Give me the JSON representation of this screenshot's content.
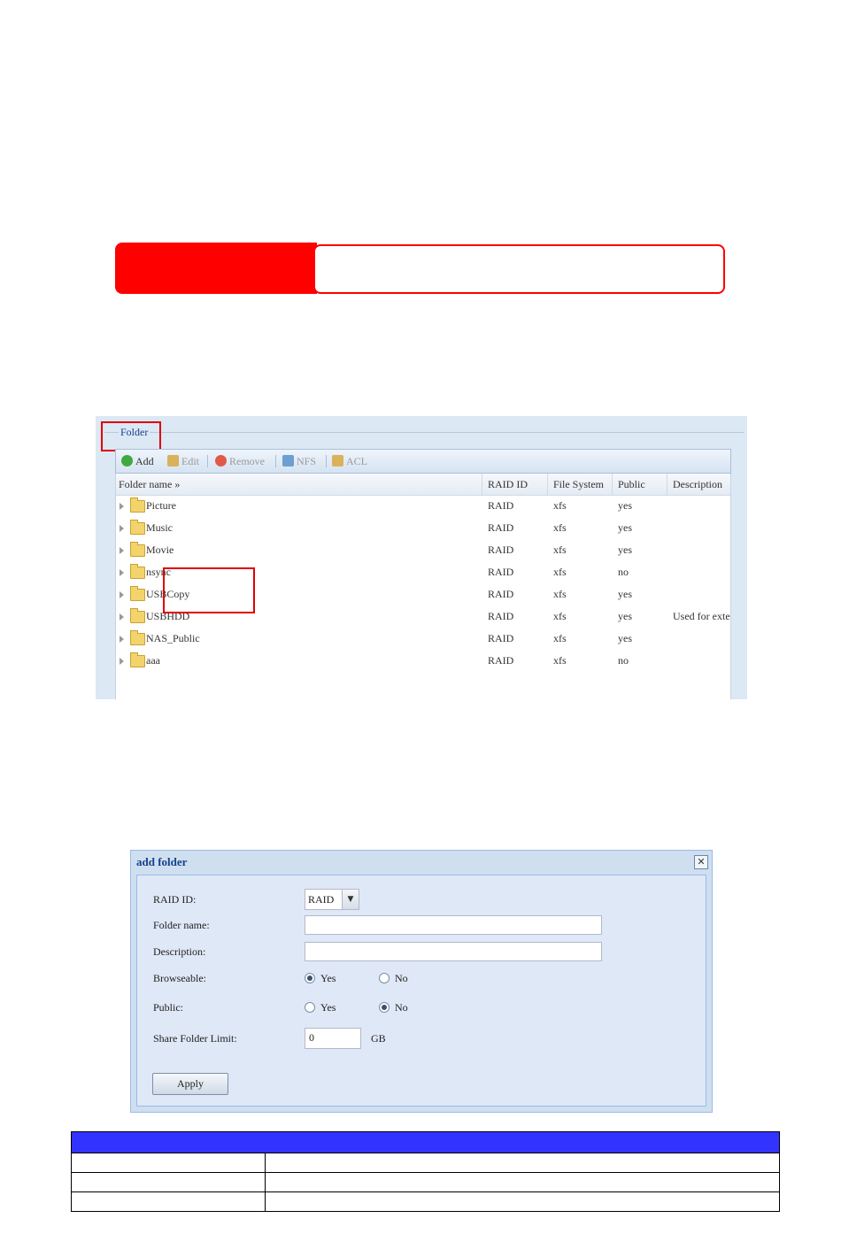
{
  "folder_panel": {
    "legend": "Folder",
    "toolbar": {
      "add": "Add",
      "edit": "Edit",
      "remove": "Remove",
      "nfs": "NFS",
      "acl": "ACL"
    },
    "columns": [
      "Folder name »",
      "RAID ID",
      "File System",
      "Public",
      "Description"
    ],
    "rows": [
      {
        "name": "Picture",
        "raid": "RAID",
        "fs": "xfs",
        "public": "yes",
        "desc": ""
      },
      {
        "name": "Music",
        "raid": "RAID",
        "fs": "xfs",
        "public": "yes",
        "desc": ""
      },
      {
        "name": "Movie",
        "raid": "RAID",
        "fs": "xfs",
        "public": "yes",
        "desc": ""
      },
      {
        "name": "nsync",
        "raid": "RAID",
        "fs": "xfs",
        "public": "no",
        "desc": ""
      },
      {
        "name": "USBCopy",
        "raid": "RAID",
        "fs": "xfs",
        "public": "yes",
        "desc": ""
      },
      {
        "name": "USBHDD",
        "raid": "RAID",
        "fs": "xfs",
        "public": "yes",
        "desc": "Used for exter"
      },
      {
        "name": "NAS_Public",
        "raid": "RAID",
        "fs": "xfs",
        "public": "yes",
        "desc": ""
      },
      {
        "name": "aaa",
        "raid": "RAID",
        "fs": "xfs",
        "public": "no",
        "desc": ""
      }
    ]
  },
  "dialog": {
    "title": "add folder",
    "close_glyph": "✕",
    "raid_label": "RAID ID:",
    "raid_value": "RAID",
    "raid_arrow": "▼",
    "folder_name_label": "Folder name:",
    "folder_name_value": "",
    "description_label": "Description:",
    "description_value": "",
    "browseable_label": "Browseable:",
    "browseable_yes": "Yes",
    "browseable_no": "No",
    "browseable_selected": "yes",
    "public_label": "Public:",
    "public_yes": "Yes",
    "public_no": "No",
    "public_selected": "no",
    "limit_label": "Share Folder Limit:",
    "limit_value": "0",
    "limit_unit": "GB",
    "apply": "Apply"
  },
  "colors": {
    "banner_red": "#ff0000",
    "table_header_blue": "#3333ff",
    "highlight_red": "#e00000"
  }
}
